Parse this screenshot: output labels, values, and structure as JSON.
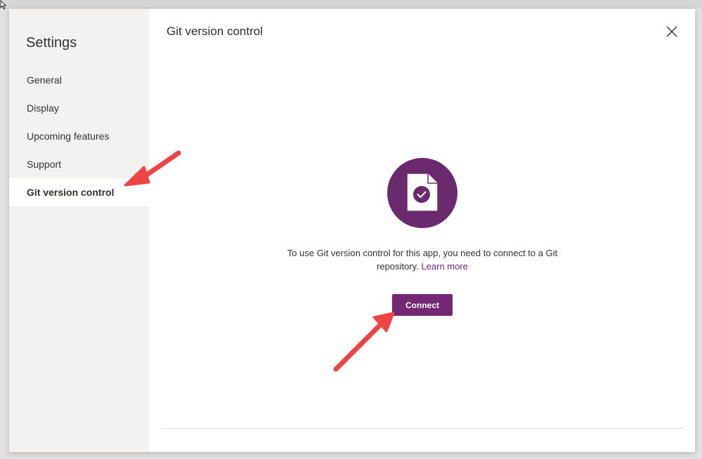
{
  "sidebar": {
    "title": "Settings",
    "items": [
      {
        "label": "General",
        "selected": false
      },
      {
        "label": "Display",
        "selected": false
      },
      {
        "label": "Upcoming features",
        "selected": false
      },
      {
        "label": "Support",
        "selected": false
      },
      {
        "label": "Git version control",
        "selected": true
      }
    ]
  },
  "main": {
    "title": "Git version control",
    "message_part1": "To use Git version control for this app, you need to connect to a Git repository.",
    "learn_more_label": "Learn more",
    "connect_label": "Connect",
    "hero_icon": "document-check-icon",
    "close_icon": "close-icon"
  },
  "colors": {
    "accent": "#742774",
    "hero_circle": "#6b2a6e",
    "sidebar_bg": "#f3f2f1",
    "annotation_arrow": "#ef4444"
  }
}
